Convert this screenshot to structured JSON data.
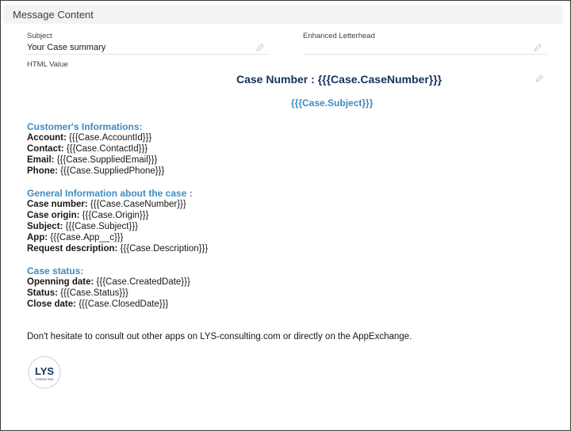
{
  "section": {
    "title": "Message Content"
  },
  "fields": {
    "subject": {
      "label": "Subject",
      "value": "Your Case summary"
    },
    "letterhead": {
      "label": "Enhanced Letterhead",
      "value": ""
    },
    "html": {
      "label": "HTML Value"
    }
  },
  "letter": {
    "title": "Case Number : {{{Case.CaseNumber}}}",
    "subject": "{{{Case.Subject}}}",
    "customer": {
      "heading": "Customer's Informations:",
      "rows": [
        {
          "k": "Account:",
          "v": " {{{Case.AccountId}}}"
        },
        {
          "k": "Contact:",
          "v": " {{{Case.ContactId}}}"
        },
        {
          "k": "Email:",
          "v": " {{{Case.SuppliedEmail}}}"
        },
        {
          "k": "Phone:",
          "v": " {{{Case.SuppliedPhone}}}"
        }
      ]
    },
    "general": {
      "heading": "General Information about the case :",
      "rows": [
        {
          "k": "Case number:",
          "v": " {{{Case.CaseNumber}}}"
        },
        {
          "k": "Case origin:",
          "v": " {{{Case.Origin}}}"
        },
        {
          "k": "Subject:",
          "v": " {{{Case.Subject}}}"
        },
        {
          "k": "App:",
          "v": " {{{Case.App__c}}}"
        },
        {
          "k": "Request description:",
          "v": " {{{Case.Description}}}"
        }
      ]
    },
    "status": {
      "heading": "Case status:",
      "rows": [
        {
          "k": "Openning date:",
          "v": " {{{Case.CreatedDate}}}"
        },
        {
          "k": "Status:",
          "v": " {{{Case.Status}}}"
        },
        {
          "k": "Close date:",
          "v": " {{{Case.ClosedDate}}}"
        }
      ]
    },
    "footer": "Don't hesitate to consult out other apps on LYS-consulting.com or directly on the AppExchange.",
    "logo": {
      "text": "LYS",
      "subtext": "CONSULTING"
    }
  },
  "colors": {
    "title": "#16325c",
    "accent": "#3b8cc4"
  }
}
